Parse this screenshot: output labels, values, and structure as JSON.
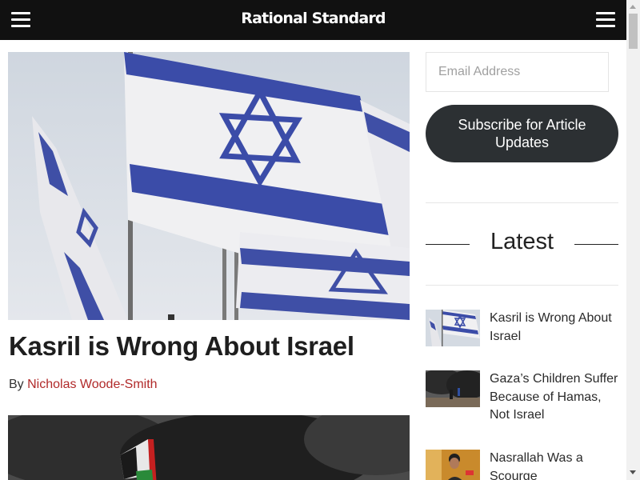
{
  "header": {
    "brand": "Rational Standard",
    "left_menu_icon": "hamburger-menu-icon",
    "right_menu_icon": "hamburger-menu-icon"
  },
  "main": {
    "hero_alt": "Israeli flags",
    "article_title": "Kasril is Wrong About Israel",
    "byline_prefix": "By",
    "author": "Nicholas Woode-Smith"
  },
  "sidebar": {
    "email_placeholder": "Email Address",
    "subscribe_label": "Subscribe for Article Updates",
    "latest_heading": "Latest",
    "items": [
      {
        "title": "Kasril is Wrong About Israel"
      },
      {
        "title": "Gaza’s Children Suffer Because of Hamas, Not Israel"
      },
      {
        "title": "Nasrallah Was a Scourge"
      }
    ]
  },
  "colors": {
    "header_bg": "#111111",
    "author_link": "#b12a2a",
    "button_bg": "#2c3033"
  }
}
